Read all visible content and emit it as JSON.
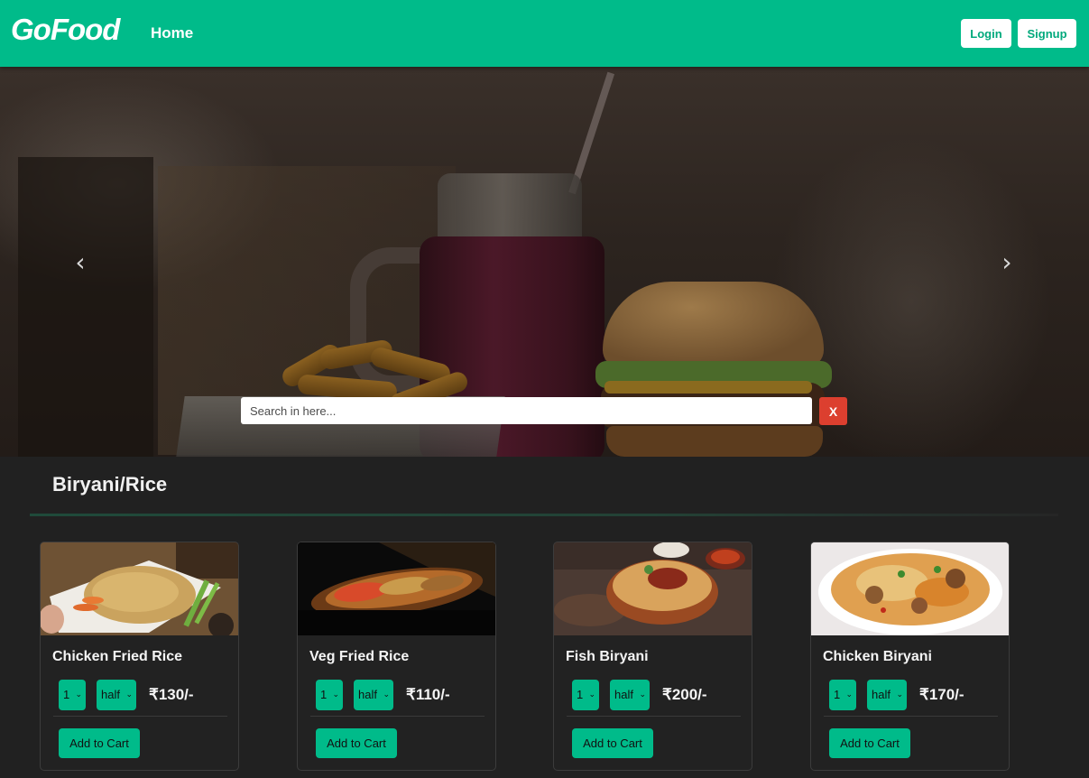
{
  "navbar": {
    "brand": "GoFood",
    "home_link": "Home",
    "login_label": "Login",
    "signup_label": "Signup",
    "accent_color": "#00bb8a"
  },
  "hero": {
    "prev_icon": "chevron-left-icon",
    "next_icon": "chevron-right-icon",
    "prev_glyph": "‹",
    "next_glyph": "›",
    "search": {
      "placeholder": "Search in here...",
      "clear_label": "X",
      "clear_color": "#dc3f2f"
    }
  },
  "category": {
    "title": "Biryani/Rice"
  },
  "cards": [
    {
      "name": "Chicken Fried Rice",
      "quantity": "1",
      "size": "half",
      "price": "₹130/-",
      "add_label": "Add to Cart"
    },
    {
      "name": "Veg Fried Rice",
      "quantity": "1",
      "size": "half",
      "price": "₹110/-",
      "add_label": "Add to Cart"
    },
    {
      "name": "Fish Biryani",
      "quantity": "1",
      "size": "half",
      "price": "₹200/-",
      "add_label": "Add to Cart"
    },
    {
      "name": "Chicken Biryani",
      "quantity": "1",
      "size": "half",
      "price": "₹170/-",
      "add_label": "Add to Cart"
    }
  ]
}
